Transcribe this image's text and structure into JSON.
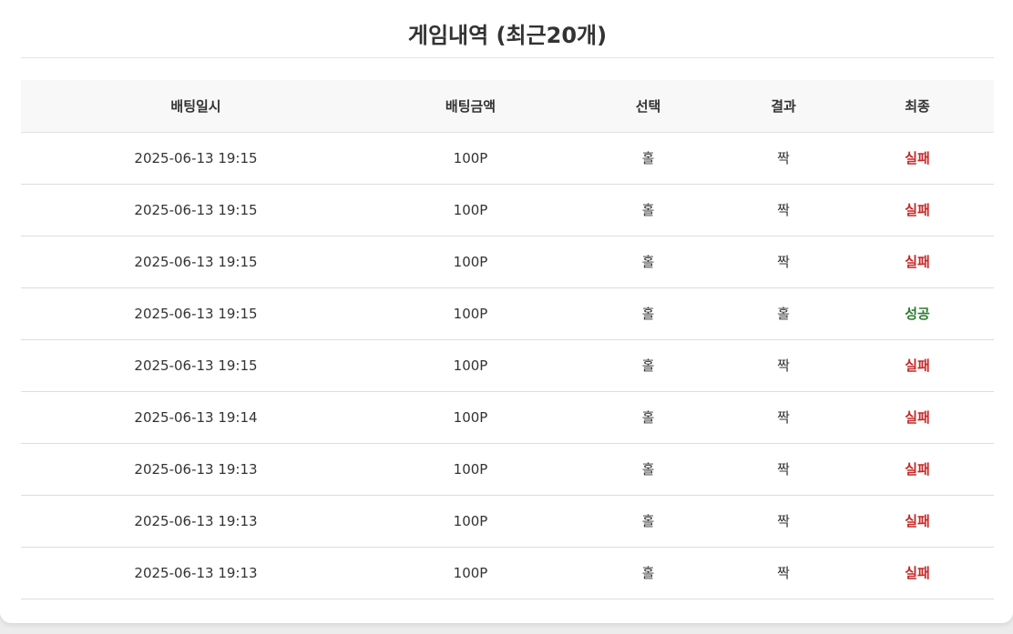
{
  "title": "게임내역 (최근20개)",
  "columns": [
    "배팅일시",
    "배팅금액",
    "선택",
    "결과",
    "최종"
  ],
  "rows": [
    {
      "datetime": "2025-06-13 19:15",
      "amount": "100P",
      "choice": "홀",
      "result": "짝",
      "final": "실패",
      "final_status": "fail"
    },
    {
      "datetime": "2025-06-13 19:15",
      "amount": "100P",
      "choice": "홀",
      "result": "짝",
      "final": "실패",
      "final_status": "fail"
    },
    {
      "datetime": "2025-06-13 19:15",
      "amount": "100P",
      "choice": "홀",
      "result": "짝",
      "final": "실패",
      "final_status": "fail"
    },
    {
      "datetime": "2025-06-13 19:15",
      "amount": "100P",
      "choice": "홀",
      "result": "홀",
      "final": "성공",
      "final_status": "success"
    },
    {
      "datetime": "2025-06-13 19:15",
      "amount": "100P",
      "choice": "홀",
      "result": "짝",
      "final": "실패",
      "final_status": "fail"
    },
    {
      "datetime": "2025-06-13 19:14",
      "amount": "100P",
      "choice": "홀",
      "result": "짝",
      "final": "실패",
      "final_status": "fail"
    },
    {
      "datetime": "2025-06-13 19:13",
      "amount": "100P",
      "choice": "홀",
      "result": "짝",
      "final": "실패",
      "final_status": "fail"
    },
    {
      "datetime": "2025-06-13 19:13",
      "amount": "100P",
      "choice": "홀",
      "result": "짝",
      "final": "실패",
      "final_status": "fail"
    },
    {
      "datetime": "2025-06-13 19:13",
      "amount": "100P",
      "choice": "홀",
      "result": "짝",
      "final": "실패",
      "final_status": "fail"
    }
  ],
  "colors": {
    "fail": "#c62828",
    "success": "#2e7d32",
    "header_bg": "#f8f8f8"
  }
}
